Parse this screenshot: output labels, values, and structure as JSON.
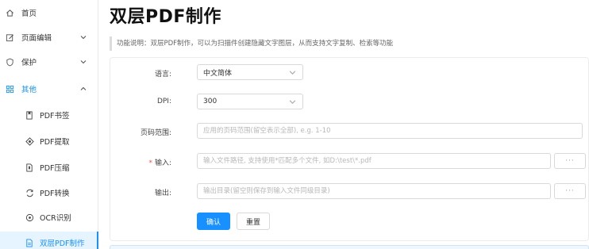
{
  "sidebar": {
    "items": [
      {
        "label": "首页",
        "icon": "home-icon"
      },
      {
        "label": "页面编辑",
        "icon": "edit-icon"
      },
      {
        "label": "保护",
        "icon": "shield-icon"
      },
      {
        "label": "其他",
        "icon": "grid-icon"
      }
    ],
    "sub_items": [
      {
        "label": "PDF书签",
        "icon": "bookmark-icon"
      },
      {
        "label": "PDF提取",
        "icon": "extract-icon"
      },
      {
        "label": "PDF压缩",
        "icon": "compress-icon"
      },
      {
        "label": "PDF转换",
        "icon": "convert-icon"
      },
      {
        "label": "OCR识别",
        "icon": "ocr-icon"
      },
      {
        "label": "双层PDF制作",
        "icon": "document-icon"
      }
    ]
  },
  "main": {
    "title": "双层PDF制作",
    "description": "功能说明：双层PDF制作，可以为扫描件创建隐藏文字图层，从而支持文字复制、检索等功能"
  },
  "form": {
    "language": {
      "label": "语言:",
      "value": "中文简体"
    },
    "dpi": {
      "label": "DPI:",
      "value": "300"
    },
    "page_range": {
      "label": "页码范围:",
      "placeholder": "应用的页码范围(留空表示全部), e.g. 1-10"
    },
    "input": {
      "required_mark": "*",
      "label": "输入:",
      "placeholder": "输入文件路径, 支持使用*匹配多个文件, 如D:\\test\\*.pdf",
      "browse_label": "···"
    },
    "output": {
      "label": "输出:",
      "placeholder": "输出目录(留空则保存到输入文件同级目录)",
      "browse_label": "···"
    }
  },
  "actions": {
    "confirm_label": "确认",
    "reset_label": "重置"
  },
  "colors": {
    "accent": "#1890ff",
    "active_bg": "#e6f4ff",
    "required": "#ff4d4f"
  }
}
